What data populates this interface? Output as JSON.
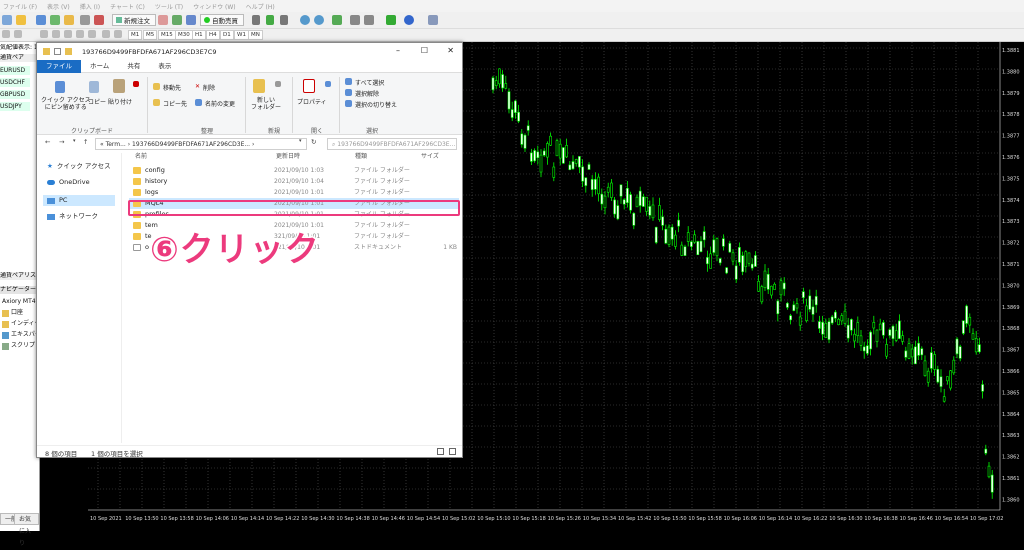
{
  "menu": [
    "ファイル (F)",
    "表示 (V)",
    "挿入 (I)",
    "チャート (C)",
    "ツール (T)",
    "ウィンドウ (W)",
    "ヘルプ (H)"
  ],
  "toolbar": {
    "new_order": "新規注文",
    "auto_trade": "自動売買",
    "timeframes": [
      "M1",
      "M5",
      "M15",
      "M30",
      "H1",
      "H4",
      "D1",
      "W1",
      "MN"
    ]
  },
  "left_panel": {
    "market_watch_header": "気配値表示: 17:0",
    "col_pair": "通貨ペア",
    "symbols": [
      "EURUSD",
      "USDCHF",
      "GBPUSD",
      "USDJPY"
    ],
    "tab_label": "通貨ペアリスト",
    "navigator_header": "ナビゲーター",
    "account": "Axiory MT4",
    "nav_items": [
      "口座",
      "インディケ",
      "エキスパー",
      "スクリプト"
    ],
    "bottom_tabs": [
      "一般",
      "お気に入り"
    ]
  },
  "explorer": {
    "title": "193766D9499FBFDFA671AF296CD3E7C9",
    "tabs": [
      "ファイル",
      "ホーム",
      "共有",
      "表示"
    ],
    "ribbon": {
      "pin": "クイック アクセス\nにピン留めする",
      "copy": "コピー",
      "paste": "貼り付け",
      "clipboard_group": "クリップボード",
      "move_to": "移動先",
      "copy_to": "コピー先",
      "delete": "削除",
      "rename": "名前の変更",
      "organize_group": "整理",
      "new_folder": "新しい\nフォルダー",
      "new_group": "新規",
      "properties": "プロパティ",
      "open_group": "開く",
      "select_all": "すべて選択",
      "select_none": "選択解除",
      "invert": "選択の切り替え",
      "select_group": "選択"
    },
    "address": "« Term... › 193766D9499FBFDFA671AF296CD3E... ›",
    "search_placeholder": "193766D9499FBFDFA671AF296CD3E...",
    "nav": [
      "クイック アクセス",
      "OneDrive",
      "PC",
      "ネットワーク"
    ],
    "columns": {
      "name": "名前",
      "date": "更新日時",
      "type": "種類",
      "size": "サイズ"
    },
    "files": [
      {
        "name": "config",
        "date": "2021/09/10 1:03",
        "type": "ファイル フォルダー",
        "size": ""
      },
      {
        "name": "history",
        "date": "2021/09/10 1:04",
        "type": "ファイル フォルダー",
        "size": ""
      },
      {
        "name": "logs",
        "date": "2021/09/10 1:01",
        "type": "ファイル フォルダー",
        "size": ""
      },
      {
        "name": "MQL4",
        "date": "2021/09/10 1:01",
        "type": "ファイル フォルダー",
        "size": ""
      },
      {
        "name": "profiles",
        "date": "2021/09/10 1:01",
        "type": "ファイル フォルダー",
        "size": ""
      },
      {
        "name": "tem",
        "date": "2021/09/10 1:01",
        "type": "ファイル フォルダー",
        "size": ""
      },
      {
        "name": "te",
        "date": "321/09/10 1:01",
        "type": "ファイル フォルダー",
        "size": ""
      },
      {
        "name": "o",
        "date": "321/09/10 1:01",
        "type": "ストドキュメント",
        "size": "1 KB"
      }
    ],
    "status_count": "8 個の項目",
    "status_selected": "1 個の項目を選択"
  },
  "annotation": "⑥クリック",
  "chart": {
    "x_labels": [
      "10 Sep 2021",
      "10 Sep 13:50",
      "10 Sep 13:58",
      "10 Sep 14:06",
      "10 Sep 14:14",
      "10 Sep 14:22",
      "10 Sep 14:30",
      "10 Sep 14:38",
      "10 Sep 14:46",
      "10 Sep 14:54",
      "10 Sep 15:02",
      "10 Sep 15:10",
      "10 Sep 15:18",
      "10 Sep 15:26",
      "10 Sep 15:34",
      "10 Sep 15:42",
      "10 Sep 15:50",
      "10 Sep 15:58",
      "10 Sep 16:06",
      "10 Sep 16:14",
      "10 Sep 16:22",
      "10 Sep 16:30",
      "10 Sep 16:38",
      "10 Sep 16:46",
      "10 Sep 16:54",
      "10 Sep 17:02"
    ],
    "y_labels": [
      "1.3881",
      "1.3880",
      "1.3879",
      "1.3878",
      "1.3877",
      "1.3876",
      "1.3875",
      "1.3874",
      "1.3873",
      "1.3872",
      "1.3871",
      "1.3870",
      "1.3869",
      "1.3868",
      "1.3867",
      "1.3866",
      "1.3865",
      "1.3864",
      "1.3863",
      "1.3862",
      "1.3861",
      "1.3860"
    ],
    "up_color": "#00ff00",
    "down_color": "#ffffff"
  }
}
